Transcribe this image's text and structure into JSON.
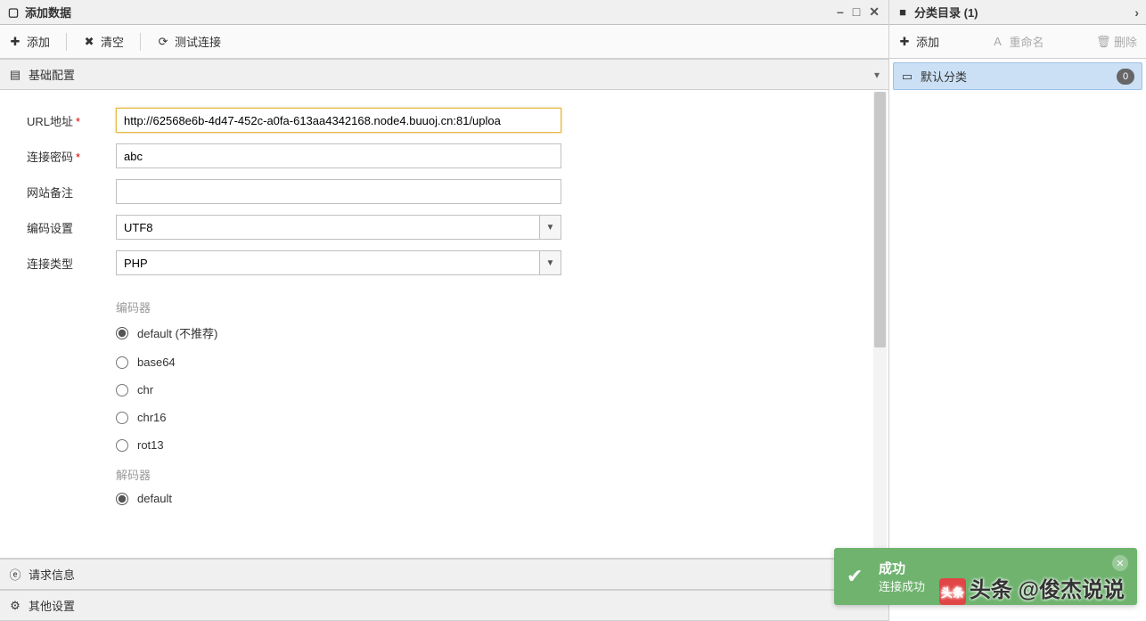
{
  "window": {
    "title": "添加数据"
  },
  "toolbar": {
    "add": "添加",
    "clear": "清空",
    "test": "测试连接"
  },
  "sections": {
    "basic": "基础配置",
    "request": "请求信息",
    "other": "其他设置"
  },
  "form": {
    "url_label": "URL地址",
    "url_value": "http://62568e6b-4d47-452c-a0fa-613aa4342168.node4.buuoj.cn:81/uploa",
    "pwd_label": "连接密码",
    "pwd_value": "abc",
    "note_label": "网站备注",
    "note_value": "",
    "enc_label": "编码设置",
    "enc_value": "UTF8",
    "type_label": "连接类型",
    "type_value": "PHP",
    "encoder_group": "编码器",
    "decoder_group": "解码器",
    "encoders": [
      {
        "label": "default (不推荐)",
        "checked": true
      },
      {
        "label": "base64",
        "checked": false
      },
      {
        "label": "chr",
        "checked": false
      },
      {
        "label": "chr16",
        "checked": false
      },
      {
        "label": "rot13",
        "checked": false
      }
    ],
    "decoders": [
      {
        "label": "default",
        "checked": true
      }
    ]
  },
  "right": {
    "title": "分类目录 (1)",
    "add": "添加",
    "rename": "重命名",
    "delete": "删除",
    "tree": {
      "default_label": "默认分类",
      "count": "0"
    }
  },
  "toast": {
    "title": "成功",
    "msg": "连接成功"
  },
  "watermark": "头条 @俊杰说说"
}
